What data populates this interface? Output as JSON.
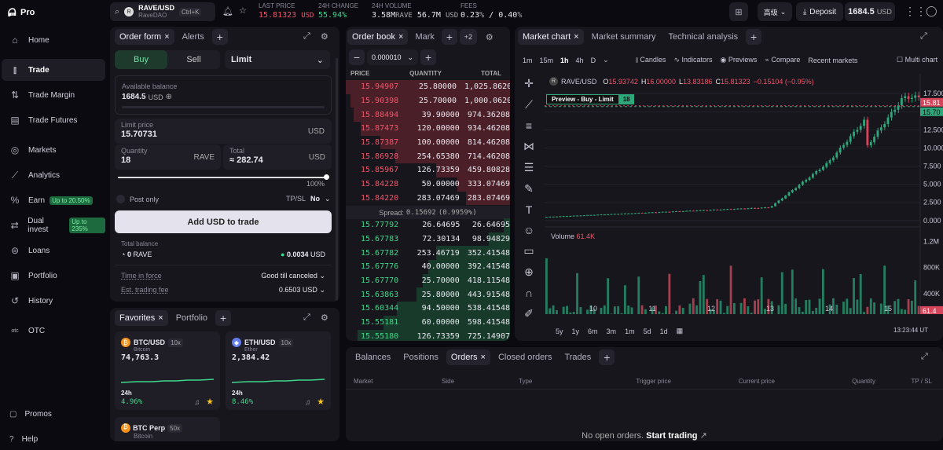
{
  "app": {
    "logo": "Pro"
  },
  "sidebar": {
    "items": [
      {
        "label": "Home",
        "icon": "home-icon"
      },
      {
        "label": "Trade",
        "icon": "trade-icon",
        "active": true
      },
      {
        "label": "Trade Margin",
        "icon": "margin-icon"
      },
      {
        "label": "Trade Futures",
        "icon": "futures-icon"
      },
      {
        "label": "Markets",
        "icon": "markets-icon"
      },
      {
        "label": "Analytics",
        "icon": "analytics-icon"
      },
      {
        "label": "Earn",
        "icon": "percent-icon",
        "badge": "Up to 20.50%"
      },
      {
        "label": "Dual invest",
        "icon": "dual-invest-icon",
        "badge": "Up to 235%"
      },
      {
        "label": "Loans",
        "icon": "loans-icon"
      },
      {
        "label": "Portfolio",
        "icon": "portfolio-icon"
      },
      {
        "label": "History",
        "icon": "history-icon"
      },
      {
        "label": "OTC",
        "icon": "otc-icon"
      }
    ],
    "promos": "Promos",
    "help": "Help"
  },
  "topbar": {
    "pair": "RAVE/USD",
    "pair_name": "RaveDAO",
    "shortcut": "Ctrl+K",
    "last_price_label": "LAST PRICE",
    "last_price": "15.81323",
    "last_price_unit": "USD",
    "change_label": "24H CHANGE",
    "change": "55.94",
    "change_unit": "%",
    "volume_label": "24H VOLUME",
    "volume_rave": "3.58M",
    "volume_rave_unit": "RAVE",
    "volume_usd": "56.7M",
    "volume_usd_unit": "USD",
    "fees_label": "FEES",
    "fee_maker": "0.23",
    "fee_taker": "0.40",
    "fee_unit": "%",
    "fee_sep": "/",
    "lang": "高级",
    "deposit": "Deposit",
    "balance": "1684.5",
    "balance_unit": "USD"
  },
  "order_form": {
    "tabs": [
      "Order form",
      "Alerts"
    ],
    "buy": "Buy",
    "sell": "Sell",
    "order_type": "Limit",
    "available_label": "Available balance",
    "available_value": "1684.5",
    "available_unit": "USD",
    "limit_label": "Limit price",
    "limit_value": "15.70731",
    "limit_unit": "USD",
    "qty_label": "Quantity",
    "qty_value": "18",
    "qty_unit": "RAVE",
    "total_label": "Total",
    "total_value": "282.74",
    "total_unit": "USD",
    "total_prefix": "≈",
    "slider_value": "100%",
    "slider_fraction": 1.0,
    "post_only": "Post only",
    "tpsl_label": "TP/SL",
    "tpsl_value": "No",
    "submit": "Add USD to trade",
    "total_balance_label": "Total balance",
    "total_balance_rave": "0",
    "total_balance_rave_unit": "RAVE",
    "total_balance_usd": "0.0034",
    "total_balance_usd_unit": "USD",
    "tif_label": "Time in force",
    "tif_value": "Good till canceled",
    "fee_label": "Est. trading fee",
    "fee_value": "0.6503",
    "fee_unit": "USD"
  },
  "favorites": {
    "tabs": [
      "Favorites",
      "Portfolio"
    ],
    "cards": [
      {
        "symbol": "BTC/USD",
        "lev": "10x",
        "name": "Bitcoin",
        "price": "74,763.3",
        "period": "24h",
        "change": "4.96",
        "change_unit": "%",
        "color": "#f7931a"
      },
      {
        "symbol": "ETH/USD",
        "lev": "10x",
        "name": "Ether",
        "price": "2,384.42",
        "period": "24h",
        "change": "8.46",
        "change_unit": "%",
        "color": "#627eea"
      }
    ],
    "perp": {
      "symbol": "BTC Perp",
      "lev": "50x",
      "name": "Bitcoin"
    }
  },
  "orderbook": {
    "tabs": [
      "Order book",
      "Mark"
    ],
    "more": "+2",
    "tick": "0.000010",
    "headers": [
      "PRICE",
      "QUANTITY",
      "TOTAL"
    ],
    "asks": [
      {
        "p": "15.94907",
        "q": "25.80000",
        "t": "1,025.86208",
        "d": 1.0
      },
      {
        "p": "15.90398",
        "q": "25.70000",
        "t": "1,000.06208",
        "d": 0.97
      },
      {
        "p": "15.88494",
        "q": "39.90000",
        "t": "974.36208",
        "d": 0.95
      },
      {
        "p": "15.87473",
        "q": "120.00000",
        "t": "934.46208",
        "d": 0.91
      },
      {
        "p": "15.87387",
        "q": "100.00000",
        "t": "814.46208",
        "d": 0.79
      },
      {
        "p": "15.86928",
        "q": "254.65380",
        "t": "714.46208",
        "d": 0.7
      },
      {
        "p": "15.85967",
        "q": "126.73359",
        "t": "459.80828",
        "d": 0.45
      },
      {
        "p": "15.84228",
        "q": "50.00000",
        "t": "333.07469",
        "d": 0.32
      },
      {
        "p": "15.84220",
        "q": "283.07469",
        "t": "283.07469",
        "d": 0.27
      }
    ],
    "spread_label": "Spread:",
    "spread": "0.15692",
    "spread_pct": "(0.9959%)",
    "bids": [
      {
        "p": "15.77792",
        "q": "26.64695",
        "t": "26.64695",
        "d": 0.04
      },
      {
        "p": "15.67783",
        "q": "72.30134",
        "t": "98.94829",
        "d": 0.13
      },
      {
        "p": "15.67782",
        "q": "253.46719",
        "t": "352.41548",
        "d": 0.45
      },
      {
        "p": "15.67776",
        "q": "40.00000",
        "t": "392.41548",
        "d": 0.5
      },
      {
        "p": "15.67770",
        "q": "25.70000",
        "t": "418.11548",
        "d": 0.53
      },
      {
        "p": "15.63863",
        "q": "25.80000",
        "t": "443.91548",
        "d": 0.57
      },
      {
        "p": "15.60344",
        "q": "94.50000",
        "t": "538.41548",
        "d": 0.69
      },
      {
        "p": "15.55181",
        "q": "60.00000",
        "t": "598.41548",
        "d": 0.77
      },
      {
        "p": "15.55180",
        "q": "126.73359",
        "t": "725.14907",
        "d": 0.93
      }
    ]
  },
  "chart": {
    "tabs": [
      "Market chart",
      "Market summary",
      "Technical analysis"
    ],
    "intervals": [
      "1m",
      "15m",
      "1h",
      "4h",
      "D"
    ],
    "active_interval": "1h",
    "tools": [
      "Candles",
      "Indicators",
      "Previews",
      "Compare",
      "Recent markets"
    ],
    "multi": "Multi chart",
    "symbol": "RAVE/USD",
    "o_label": "O",
    "o": "15.93742",
    "h_label": "H",
    "h": "16.00000",
    "l_label": "L",
    "l": "13.83186",
    "c_label": "C",
    "c": "15.81323",
    "chg": "−0.15104 (−0.95%)",
    "preview_label": "Preview - Buy - Limit",
    "preview_qty": "18",
    "price_axis": [
      "17.500",
      "15.000",
      "12.500",
      "10.000",
      "7.500",
      "5.000",
      "2.500",
      "0.000"
    ],
    "price_tag_last": "15.81",
    "price_tag_limit": "15.70",
    "volume_label": "Volume",
    "volume_value": "61.4K",
    "vol_axis": [
      "1.2M",
      "800K",
      "400K"
    ],
    "vol_tag": "61.4",
    "x_axis": [
      "10",
      "11",
      "12",
      "13",
      "14",
      "15"
    ],
    "ranges": [
      "5y",
      "1y",
      "6m",
      "3m",
      "1m",
      "5d",
      "1d"
    ],
    "time": "13:23:44 UT",
    "line_color_up": "#2ea77a",
    "line_color_down": "#d6455a"
  },
  "bottom": {
    "tabs": [
      "Balances",
      "Positions",
      "Orders",
      "Closed orders",
      "Trades"
    ],
    "active": "Orders",
    "columns": [
      "Market",
      "Side",
      "Type",
      "Trigger price",
      "Current price",
      "Quantity",
      "TP / SL"
    ],
    "empty": "No open orders.",
    "cta": "Start trading"
  }
}
